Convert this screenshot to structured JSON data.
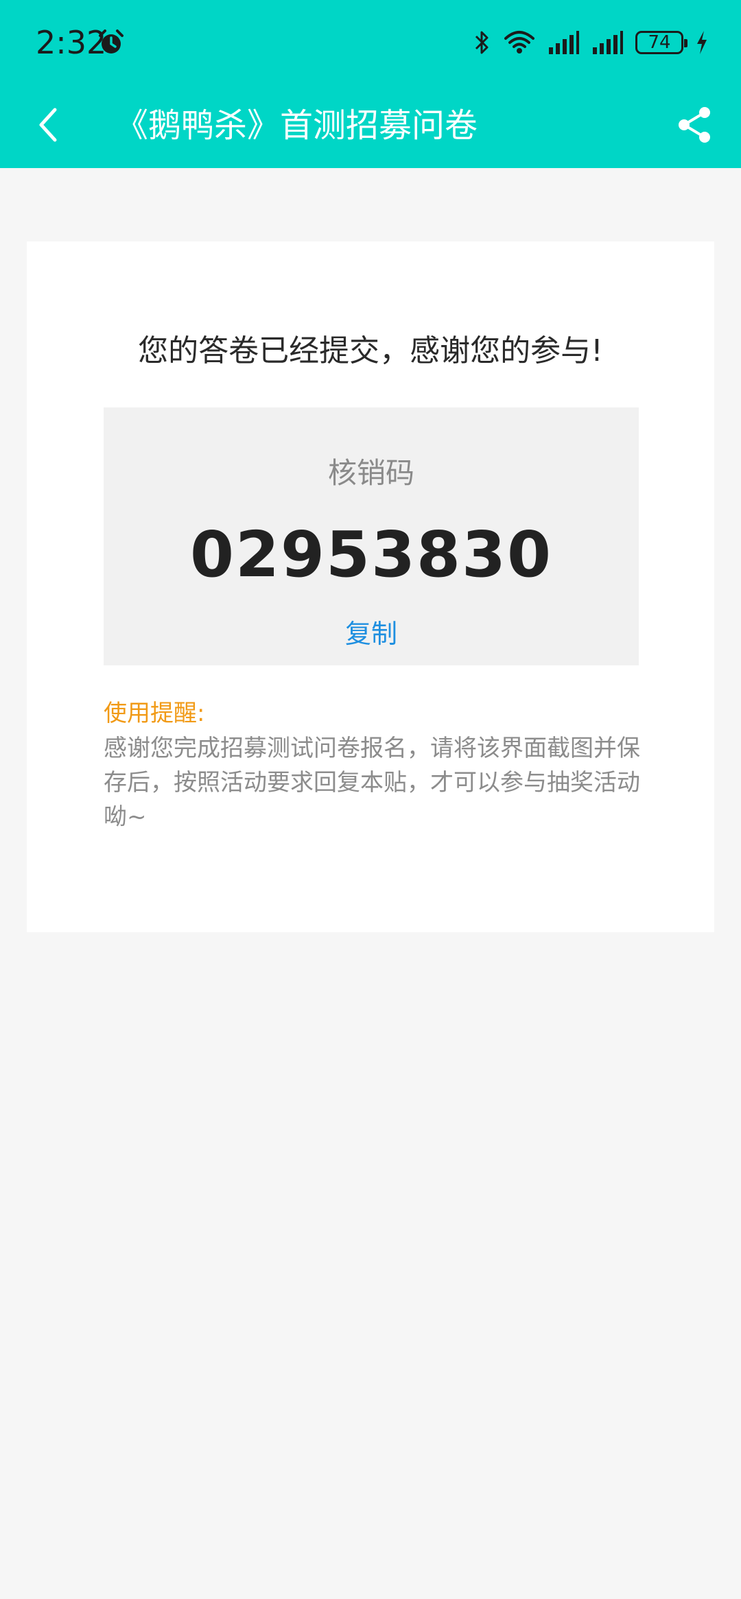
{
  "status_bar": {
    "time": "2:32",
    "battery_level": "74",
    "icons": [
      "alarm-icon",
      "bluetooth-icon",
      "wifi-icon",
      "signal-icon",
      "signal-icon",
      "battery-icon",
      "charging-icon"
    ]
  },
  "header": {
    "title": "《鹅鸭杀》首测招募问卷",
    "background_color": "#00d6c6"
  },
  "card": {
    "success_message": "您的答卷已经提交，感谢您的参与!",
    "code_label": "核销码",
    "code_value": "02953830",
    "copy_label": "复制",
    "reminder_title": "使用提醒:",
    "reminder_text": "感谢您完成招募测试问卷报名，请将该界面截图并保存后，按照活动要求回复本贴，才可以参与抽奖活动呦~"
  },
  "colors": {
    "accent": "#00d6c6",
    "link": "#1e8fe0",
    "warning": "#f19a16"
  }
}
